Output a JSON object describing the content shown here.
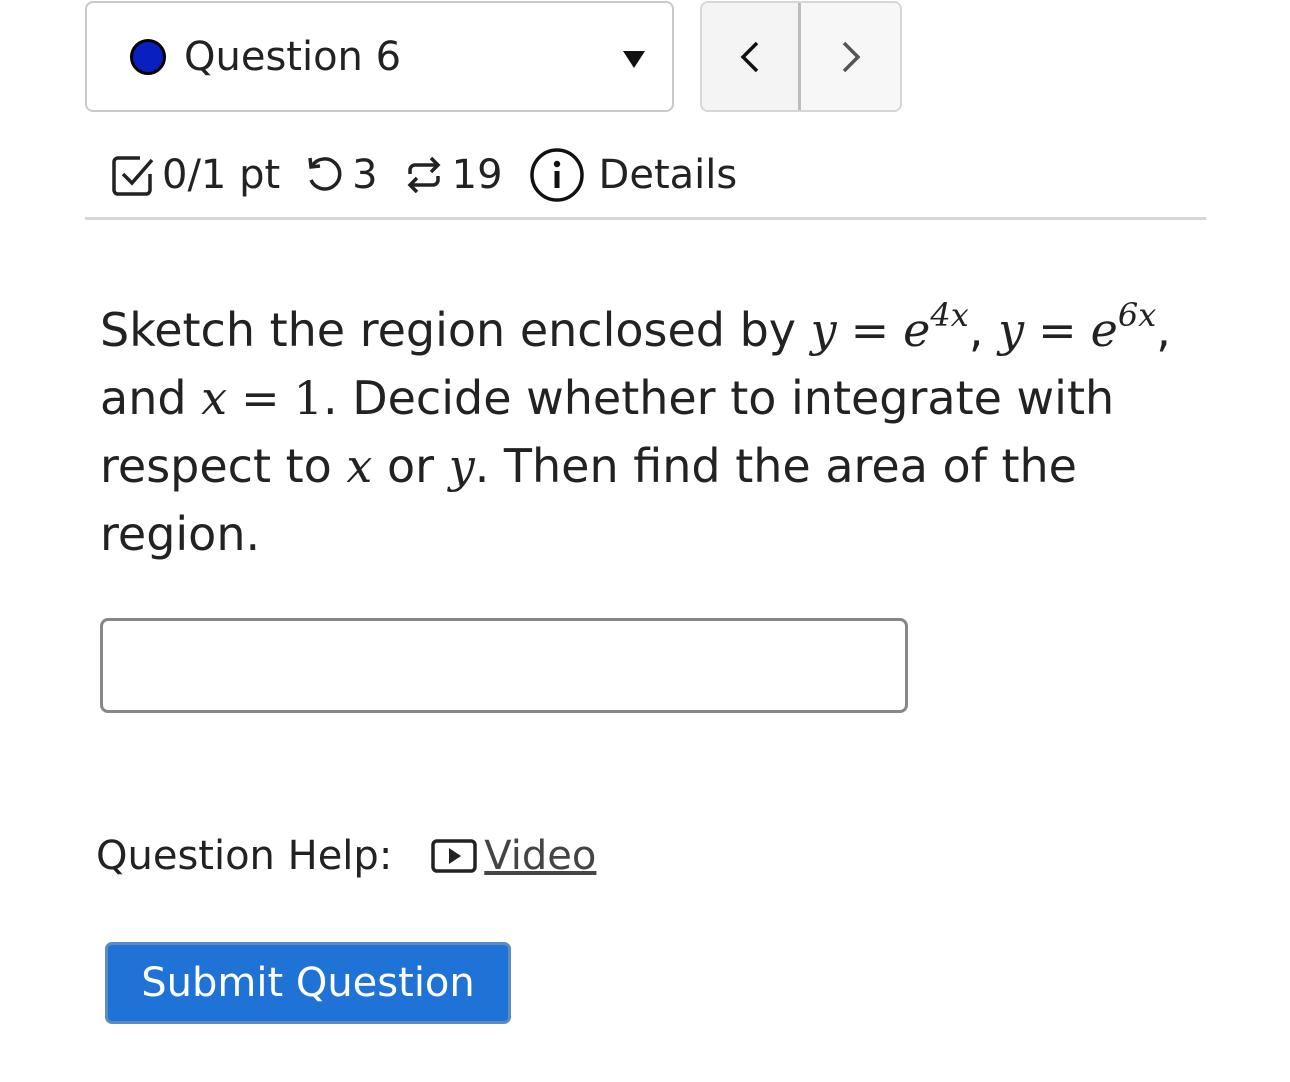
{
  "question_nav": {
    "title": "Question 6",
    "status_color": "#0a1fbf",
    "prev_icon": "chevron-left-icon",
    "next_icon": "chevron-right-icon"
  },
  "status": {
    "score": "0/1 pt",
    "retries": "3",
    "attempts": "19",
    "details_label": "Details"
  },
  "question": {
    "text_intro": "Sketch the region enclosed by",
    "curve1_lhs": "y",
    "curve1_rhs_base": "e",
    "curve1_exp": "4x",
    "curve2_lhs": "y",
    "curve2_rhs_base": "e",
    "curve2_exp": "6x",
    "text_and": "and",
    "line_lhs": "x",
    "line_rhs": "1",
    "text_decide": ". Decide whether to integrate with respect to",
    "var_x": "x",
    "text_or": "or",
    "var_y": "y",
    "text_rest": ". Then find the area of the region."
  },
  "answer": {
    "value": ""
  },
  "help": {
    "label": "Question Help:",
    "video_label": "Video"
  },
  "submit": {
    "label": "Submit Question"
  },
  "colors": {
    "accent": "#1f73d6"
  }
}
